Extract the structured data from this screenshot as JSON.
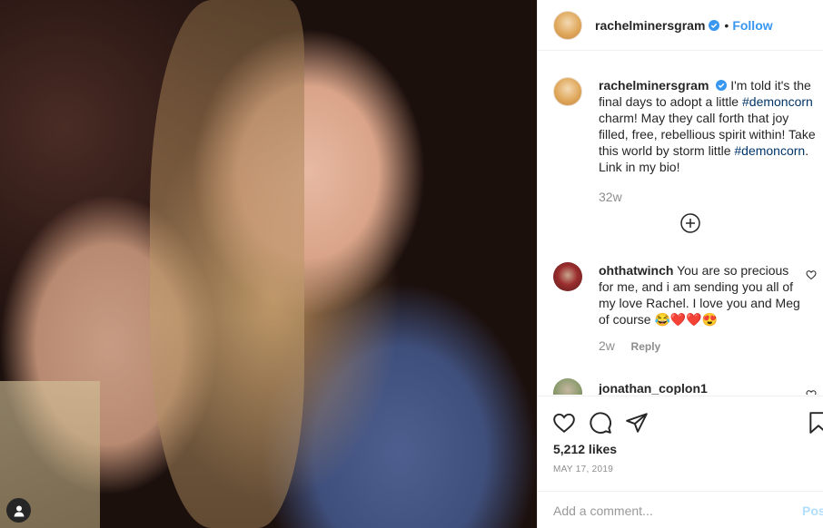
{
  "post": {
    "author": "rachelminersgram",
    "follow_label": "Follow",
    "dot": "•",
    "caption_author": "rachelminersgram",
    "caption": {
      "p1": "I'm told it's the final days to adopt a little ",
      "tag1": "#demoncorn",
      "p2": " charm! May they call forth that joy filled, free, rebellious spirit within! Take this world by storm little ",
      "tag2": "#demoncorn",
      "p3": ". Link in my bio!"
    },
    "caption_time": "32w",
    "likes": "5,212 likes",
    "date": "MAY 17, 2019"
  },
  "comments": [
    {
      "user": "ohthatwinch",
      "text": "You are so precious for me, and i am sending you all of my love Rachel. I love you and Meg of course ",
      "emojis": "😂❤️❤️😍",
      "time": "2w",
      "reply_label": "Reply"
    },
    {
      "user": "jonathan_coplon1"
    }
  ],
  "add_comment": {
    "placeholder": "Add a comment...",
    "post_label": "Post"
  },
  "icons": {
    "like": "heart-icon",
    "comment": "comment-icon",
    "share": "share-icon",
    "save": "bookmark-icon",
    "load_more": "plus-circle-icon",
    "verified": "verified-badge-icon",
    "user_tag": "user-tag-icon"
  },
  "colors": {
    "accent": "#3897f0",
    "hashtag": "#003569",
    "muted": "#8e8e8e",
    "post_disabled": "#b2dffc"
  }
}
